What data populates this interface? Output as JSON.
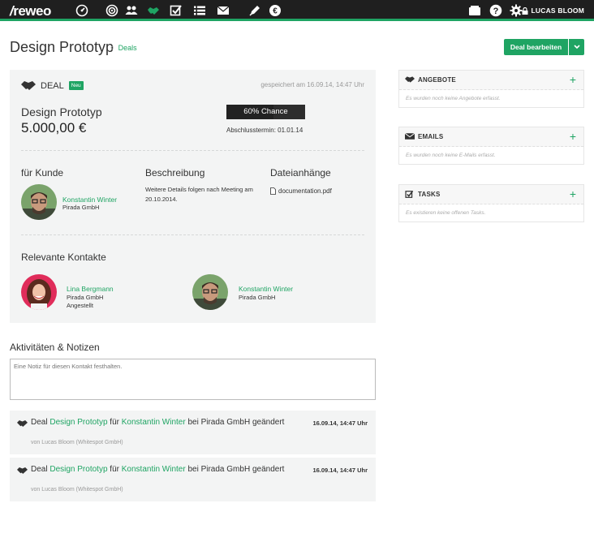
{
  "topbar": {
    "logo": "reweo",
    "user": "LUCAS BLOOM",
    "icons": [
      "dashboard-icon",
      "target-icon",
      "contacts-icon",
      "deals-icon",
      "tasks-icon",
      "list-icon",
      "mail-icon",
      "pen-icon",
      "euro-icon",
      "folder-icon",
      "help-icon",
      "settings-icon",
      "lock-icon"
    ],
    "accent": "#1fa463",
    "bg": "#1f1f1f"
  },
  "header": {
    "title": "Design Prototyp",
    "breadcrumb": "Deals",
    "edit_button": "Deal bearbeiten"
  },
  "deal": {
    "label": "DEAL",
    "badge": "Neu",
    "saved": "gespeichert am 16.09.14, 14:47 Uhr",
    "name": "Design Prototyp",
    "amount": "5.000,00 €",
    "chance_label": "60% Chance",
    "chance_value": 0.6,
    "closing": "Abschlusstermin: 01.01.14",
    "customer_heading": "für Kunde",
    "customer_name": "Konstantin Winter",
    "customer_company": "Pirada GmbH",
    "description_heading": "Beschreibung",
    "description": "Weitere Details folgen nach Meeting am 20.10.2014.",
    "attachments_heading": "Dateianhänge",
    "attachment": "documentation.pdf",
    "contacts_heading": "Relevante Kontakte",
    "contacts": [
      {
        "name": "Lina Bergmann",
        "company": "Pirada GmbH",
        "role": "Angestellt"
      },
      {
        "name": "Konstantin Winter",
        "company": "Pirada GmbH",
        "role": ""
      }
    ]
  },
  "activities": {
    "heading": "Aktivitäten & Notizen",
    "placeholder": "Eine Notiz für diesen Kontakt festhalten.",
    "items": [
      {
        "pre": "Deal ",
        "deal": "Design Prototyp",
        "mid": " für ",
        "contact": "Konstantin Winter",
        "post": " bei Pirada GmbH geändert",
        "by": "von Lucas Bloom (Whitespot GmbH)",
        "time": "16.09.14, 14:47 Uhr"
      },
      {
        "pre": "Deal ",
        "deal": "Design Prototyp",
        "mid": " für ",
        "contact": "Konstantin Winter",
        "post": " bei Pirada GmbH geändert",
        "by": "von Lucas Bloom (Whitespot GmbH)",
        "time": "16.09.14, 14:47 Uhr"
      }
    ]
  },
  "sidebar": {
    "panels": [
      {
        "title": "ANGEBOTE",
        "empty": "Es wurden noch keine Angebote erfasst.",
        "icon": "handshake-icon"
      },
      {
        "title": "EMAILS",
        "empty": "Es wurden noch keine E-Mails erfasst.",
        "icon": "mail-icon"
      },
      {
        "title": "TASKS",
        "empty": "Es existieren keine offenen Tasks.",
        "icon": "checkbox-icon"
      }
    ],
    "plus": "+"
  }
}
